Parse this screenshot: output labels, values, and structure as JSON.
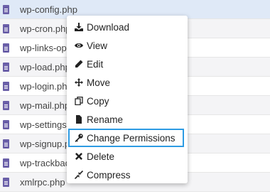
{
  "files": [
    {
      "name": "wp-config.php"
    },
    {
      "name": "wp-cron.php"
    },
    {
      "name": "wp-links-op"
    },
    {
      "name": "wp-load.php"
    },
    {
      "name": "wp-login.ph"
    },
    {
      "name": "wp-mail.php"
    },
    {
      "name": "wp-settings"
    },
    {
      "name": "wp-signup.p"
    },
    {
      "name": "wp-trackbac"
    },
    {
      "name": "xmlrpc.php"
    }
  ],
  "context_menu": {
    "items": [
      {
        "label": "Download",
        "icon": "download-icon"
      },
      {
        "label": "View",
        "icon": "eye-icon"
      },
      {
        "label": "Edit",
        "icon": "pencil-icon"
      },
      {
        "label": "Move",
        "icon": "move-arrows-icon"
      },
      {
        "label": "Copy",
        "icon": "copy-icon"
      },
      {
        "label": "Rename",
        "icon": "file-icon"
      },
      {
        "label": "Change Permissions",
        "icon": "key-icon"
      },
      {
        "label": "Delete",
        "icon": "x-icon"
      },
      {
        "label": "Compress",
        "icon": "compress-icon"
      }
    ]
  },
  "colors": {
    "file_icon": "#6a5fa8",
    "highlight_border": "#2d9be3",
    "selected_row": "#dfe9f7"
  }
}
